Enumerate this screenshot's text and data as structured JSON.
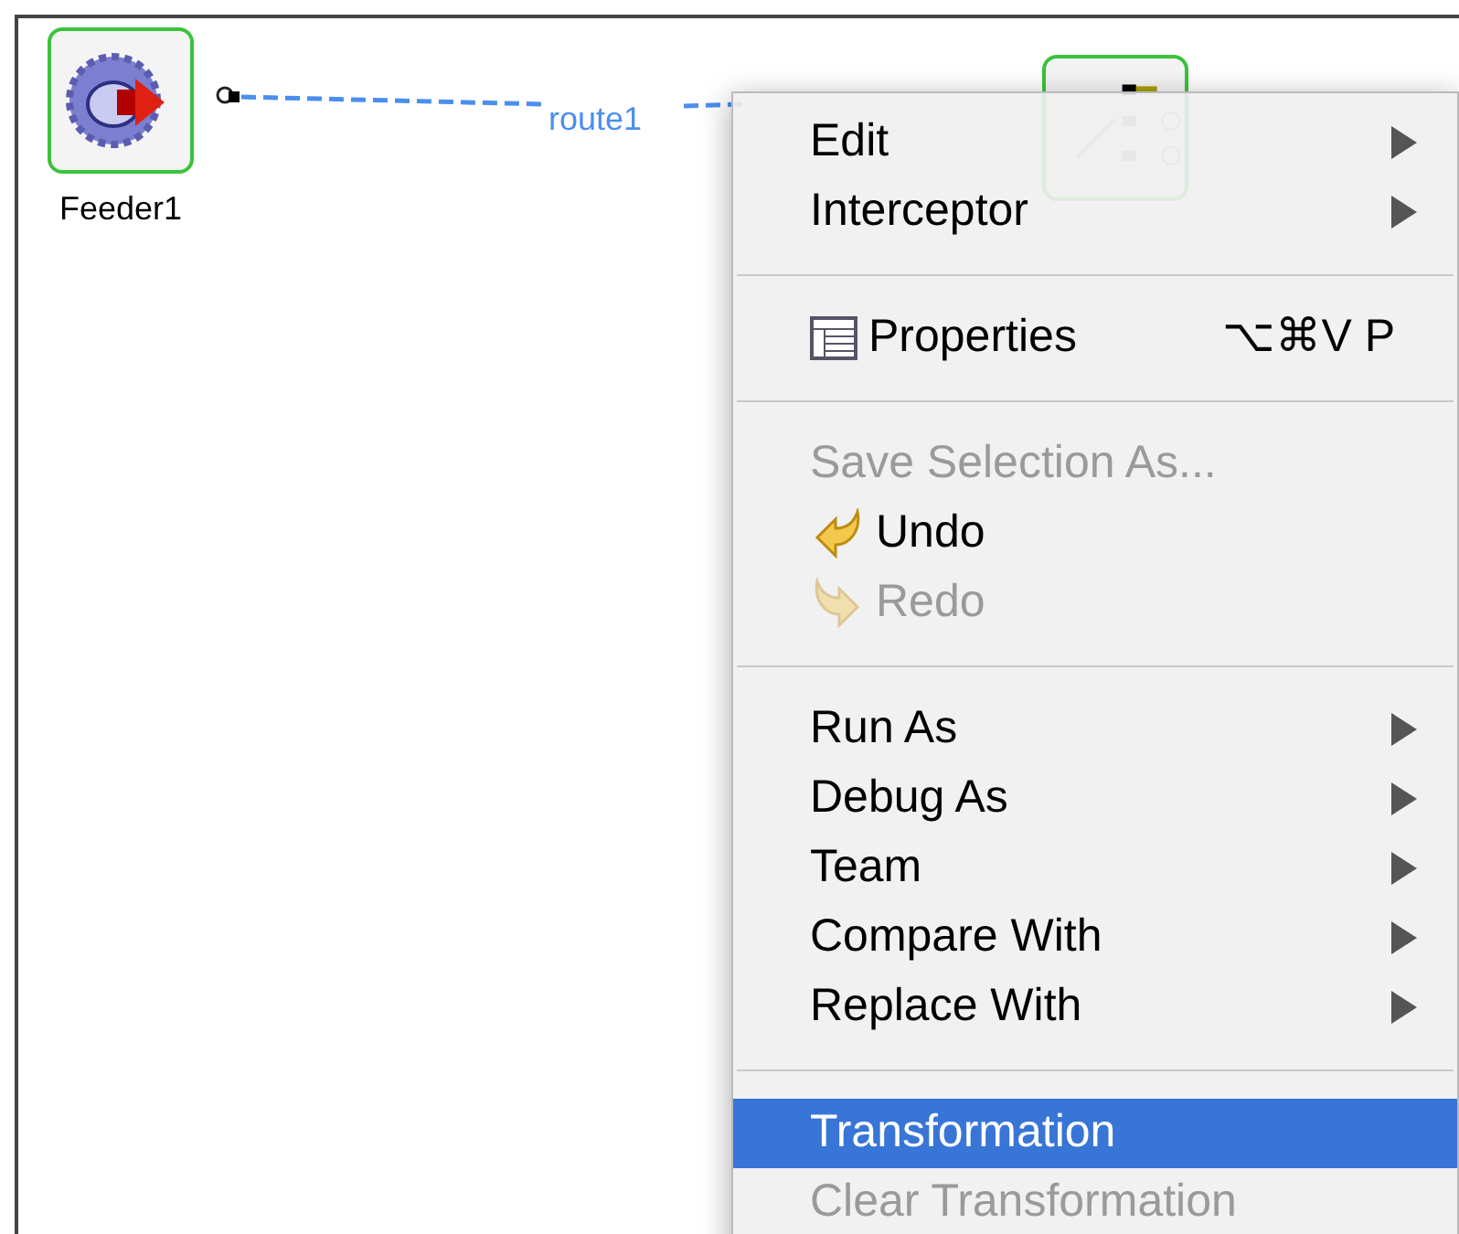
{
  "canvas": {
    "nodes": [
      {
        "label": "Feeder1",
        "kind": "feeder"
      },
      {
        "kind": "router"
      }
    ],
    "connection": {
      "label": "route1"
    }
  },
  "context_menu": {
    "items": [
      {
        "kind": "submenu",
        "label": "Edit",
        "disabled": false,
        "selected": false
      },
      {
        "kind": "submenu",
        "label": "Interceptor",
        "disabled": false,
        "selected": false
      },
      {
        "kind": "separator"
      },
      {
        "kind": "properties",
        "label": "Properties",
        "shortcut": "⌥⌘V P",
        "disabled": false,
        "selected": false
      },
      {
        "kind": "separator"
      },
      {
        "kind": "command",
        "label": "Save Selection As...",
        "disabled": true,
        "selected": false
      },
      {
        "kind": "undo",
        "label": "Undo",
        "disabled": false,
        "selected": false
      },
      {
        "kind": "redo",
        "label": "Redo",
        "disabled": true,
        "selected": false
      },
      {
        "kind": "separator"
      },
      {
        "kind": "submenu",
        "label": "Run As",
        "disabled": false,
        "selected": false
      },
      {
        "kind": "submenu",
        "label": "Debug As",
        "disabled": false,
        "selected": false
      },
      {
        "kind": "submenu",
        "label": "Team",
        "disabled": false,
        "selected": false
      },
      {
        "kind": "submenu",
        "label": "Compare With",
        "disabled": false,
        "selected": false
      },
      {
        "kind": "submenu",
        "label": "Replace With",
        "disabled": false,
        "selected": false
      },
      {
        "kind": "separator"
      },
      {
        "kind": "command",
        "label": "Transformation",
        "disabled": false,
        "selected": true
      },
      {
        "kind": "command",
        "label": "Clear Transformation",
        "disabled": true,
        "selected": false
      }
    ]
  }
}
